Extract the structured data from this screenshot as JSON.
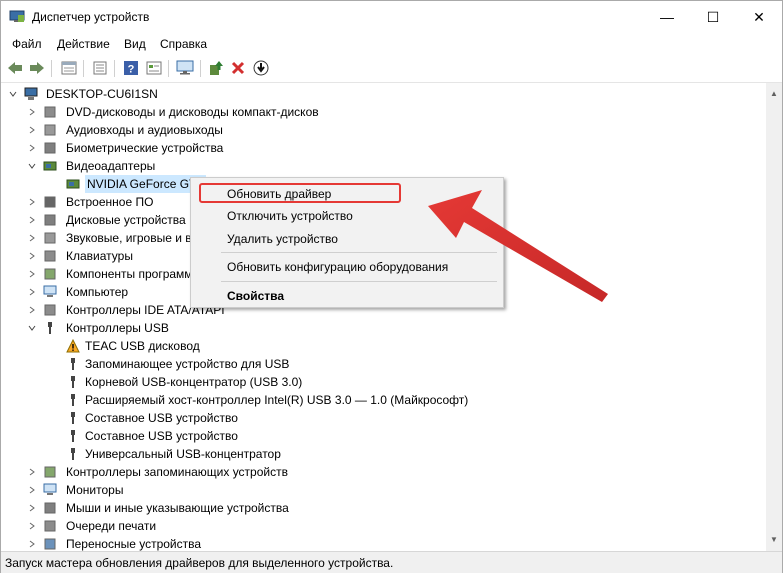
{
  "window": {
    "title": "Диспетчер устройств",
    "minimize": "—",
    "maximize": "☐",
    "close": "✕"
  },
  "menu": [
    "Файл",
    "Действие",
    "Вид",
    "Справка"
  ],
  "toolbar": {
    "icons": [
      "back-icon",
      "forward-icon",
      "properties-icon",
      "list-icon",
      "help-icon",
      "view-icon",
      "monitor-icon",
      "update-driver-icon",
      "remove-icon",
      "download-icon"
    ]
  },
  "tree": {
    "root": "DESKTOP-CU6I1SN",
    "items": [
      {
        "label": "DVD-дисководы и дисководы компакт-дисков",
        "icon": "dvd-icon"
      },
      {
        "label": "Аудиовходы и аудиовыходы",
        "icon": "audio-icon"
      },
      {
        "label": "Биометрические устройства",
        "icon": "biometric-icon"
      },
      {
        "label": "Видеоадаптеры",
        "icon": "display-adapter-icon"
      },
      {
        "label": "NVIDIA GeForce GTX",
        "icon": "display-adapter-icon"
      },
      {
        "label": "Встроенное ПО",
        "icon": "firmware-icon"
      },
      {
        "label": "Дисковые устройства",
        "icon": "disk-icon"
      },
      {
        "label": "Звуковые, игровые и в",
        "icon": "sound-icon"
      },
      {
        "label": "Клавиатуры",
        "icon": "keyboard-icon"
      },
      {
        "label": "Компоненты программ",
        "icon": "software-icon"
      },
      {
        "label": "Компьютер",
        "icon": "computer-icon"
      },
      {
        "label": "Контроллеры IDE ATA/ATAPI",
        "icon": "ide-icon"
      },
      {
        "label": "Контроллеры USB",
        "icon": "usb-icon"
      },
      {
        "label": "TEAC USB дисковод",
        "icon": "warning-icon"
      },
      {
        "label": "Запоминающее устройство для USB",
        "icon": "usb-icon"
      },
      {
        "label": "Корневой USB-концентратор (USB 3.0)",
        "icon": "usb-icon"
      },
      {
        "label": "Расширяемый хост-контроллер Intel(R) USB 3.0 — 1.0 (Майкрософт)",
        "icon": "usb-icon"
      },
      {
        "label": "Составное USB устройство",
        "icon": "usb-icon"
      },
      {
        "label": "Составное USB устройство",
        "icon": "usb-icon"
      },
      {
        "label": "Универсальный USB-концентратор",
        "icon": "usb-icon"
      },
      {
        "label": "Контроллеры запоминающих устройств",
        "icon": "storage-icon"
      },
      {
        "label": "Мониторы",
        "icon": "monitor-icon"
      },
      {
        "label": "Мыши и иные указывающие устройства",
        "icon": "mouse-icon"
      },
      {
        "label": "Очереди печати",
        "icon": "printer-icon"
      },
      {
        "label": "Переносные устройства",
        "icon": "portable-icon"
      }
    ]
  },
  "context_menu": {
    "items": [
      "Обновить драйвер",
      "Отключить устройство",
      "Удалить устройство",
      "Обновить конфигурацию оборудования",
      "Свойства"
    ]
  },
  "status": "Запуск мастера обновления драйверов для выделенного устройства.",
  "colors": {
    "accent": "#e53935",
    "folder": "#2b579a"
  }
}
